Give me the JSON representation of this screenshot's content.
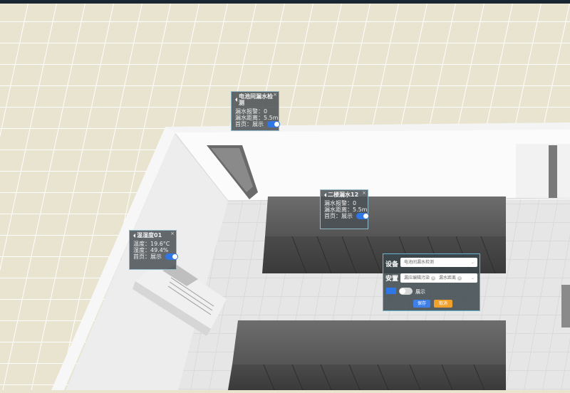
{
  "popups": {
    "battery_leak": {
      "title": "电池间漏水检测",
      "alarm": "漏水报警：0",
      "distance": "漏水距离：5.5m",
      "home": "首页：展示",
      "close": "×"
    },
    "floor2_leak": {
      "title": "二楼漏水12",
      "alarm": "漏水报警：0",
      "distance": "漏水距离：5.5m",
      "home": "首页：展示",
      "close": "×"
    },
    "temp_humidity": {
      "title": "温湿度01",
      "temperature": "温度：19.6°C",
      "humidity": "湿度：49.4%",
      "home": "首页：展示",
      "close": "×"
    }
  },
  "settings_panel": {
    "device_label": "设备",
    "device_value": "电池间漏水检测",
    "attr_label": "安置",
    "attr_tags": [
      "漏应编辑污染",
      "漏水距离"
    ],
    "display_label": "展示",
    "save_label": "保存",
    "cancel_label": "取消"
  },
  "colors": {
    "toggle_on": "#2f76e6",
    "save_button": "#3f7fe8",
    "cancel_button": "#f0a12c"
  }
}
